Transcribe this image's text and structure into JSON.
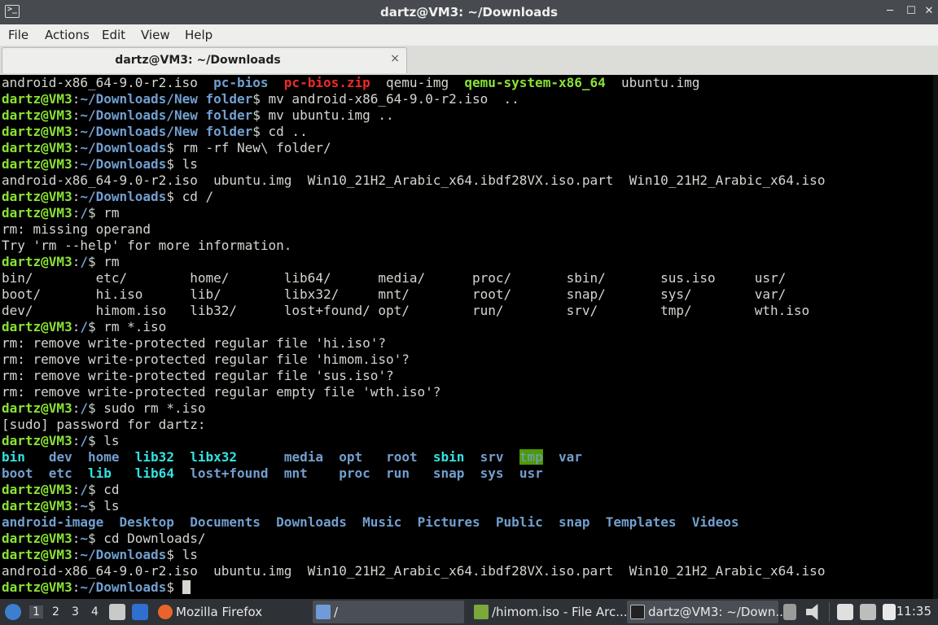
{
  "window": {
    "title": "dartz@VM3: ~/Downloads",
    "controls": {
      "minimize": "─",
      "maximize": "☐",
      "close": "✕"
    }
  },
  "menu": [
    "File",
    "Actions",
    "Edit",
    "View",
    "Help"
  ],
  "tab": {
    "label": "dartz@VM3: ~/Downloads",
    "close": "×"
  },
  "prompts": {
    "user": "dartz@VM3",
    "newfolder": "~/Downloads/New folder",
    "downloads": "~/Downloads",
    "root": "/",
    "home": "~"
  },
  "terminal": {
    "line1": [
      "android-x86_64-9.0-r2.iso",
      "pc-bios",
      "pc-bios.zip",
      "qemu-img",
      "qemu-system-x86_64",
      "ubuntu.img"
    ],
    "cmds": {
      "c1": "mv android-x86_64-9.0-r2.iso  ..",
      "c2": "mv ubuntu.img ..",
      "c3": "cd ..",
      "c4": "rm -rf New\\ folder/",
      "c5": "ls",
      "c6": "cd /",
      "c7": "rm",
      "c8": "rm",
      "c9": "rm *.iso",
      "c10": "sudo rm *.iso",
      "c11": "ls",
      "c12": "cd",
      "c13": "ls",
      "c14": "cd Downloads/",
      "c15": "ls"
    },
    "ls_downloads": "android-x86_64-9.0-r2.iso  ubuntu.img  Win10_21H2_Arabic_x64.ibdf28VX.iso.part  Win10_21H2_Arabic_x64.iso",
    "rm_missing": "rm: missing operand",
    "rm_help": "Try 'rm --help' for more information.",
    "ls_root_1": "bin/        etc/        home/       lib64/      media/      proc/       sbin/       sus.iso     usr/",
    "ls_root_2": "boot/       hi.iso      lib/        libx32/     mnt/        root/       snap/       sys/        var/",
    "ls_root_3": "dev/        himom.iso   lib32/      lost+found/ opt/        run/        srv/        tmp/        wth.iso",
    "rm_prompt1": "rm: remove write-protected regular file 'hi.iso'?",
    "rm_prompt2": "rm: remove write-protected regular file 'himom.iso'?",
    "rm_prompt3": "rm: remove write-protected regular file 'sus.iso'?",
    "rm_prompt4": "rm: remove write-protected regular empty file 'wth.iso'?",
    "sudo_prompt": "[sudo] password for dartz:",
    "root_row1": {
      "bin": "bin",
      "dev": "dev",
      "home": "home",
      "lib32": "lib32",
      "libx32": "libx32",
      "media": "media",
      "opt": "opt",
      "root": "root",
      "sbin": "sbin",
      "srv": "srv",
      "tmp": "tmp",
      "var": "var"
    },
    "root_row2": {
      "boot": "boot",
      "etc": "etc",
      "lib": "lib",
      "lib64": "lib64",
      "lostfound": "lost+found",
      "mnt": "mnt",
      "proc": "proc",
      "run": "run",
      "snap": "snap",
      "sys": "sys",
      "usr": "usr"
    },
    "home_ls": [
      "android-image",
      "Desktop",
      "Documents",
      "Downloads",
      "Music",
      "Pictures",
      "Public",
      "snap",
      "Templates",
      "Videos"
    ]
  },
  "taskbar": {
    "workspaces": [
      "1",
      "2",
      "3",
      "4"
    ],
    "tasks": [
      {
        "label": "Mozilla Firefox",
        "icon": "firefox-icon"
      },
      {
        "label": "/",
        "icon": "folder-icon"
      },
      {
        "label": "/himom.iso - File Arc...",
        "icon": "archive-icon"
      },
      {
        "label": "dartz@VM3: ~/Down...",
        "icon": "terminal-icon"
      }
    ],
    "clock": "11:35"
  },
  "colors": {
    "prompt_user": "#8ae234",
    "prompt_path": "#729fcf",
    "archive": "#ef2929",
    "symlink": "#34e2e2"
  }
}
